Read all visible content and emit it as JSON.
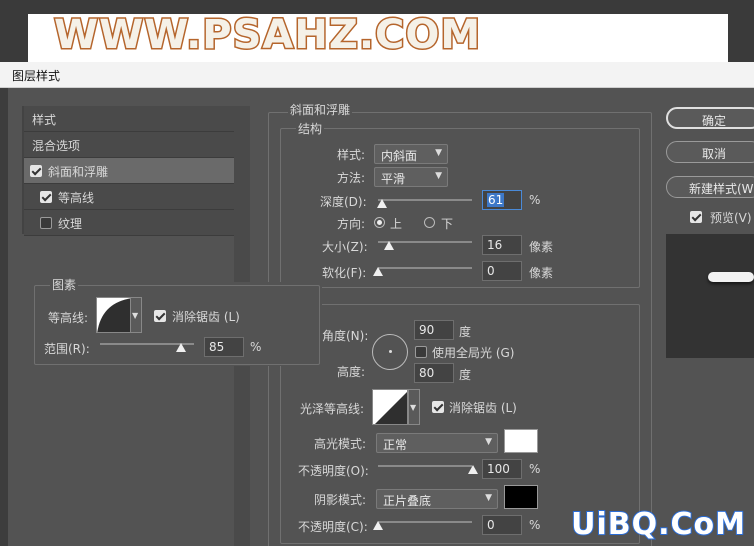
{
  "banner": {
    "text": "WWW.PSAHZ.COM"
  },
  "window": {
    "title": "图层样式"
  },
  "styles_list": {
    "items": [
      {
        "label": "样式"
      },
      {
        "label": "混合选项"
      },
      {
        "label": "斜面和浮雕",
        "checked": true,
        "selected": true
      },
      {
        "label": "等高线",
        "checked": true
      },
      {
        "label": "纹理",
        "checked": false
      }
    ]
  },
  "elements_group": {
    "title": "图素",
    "contour_label": "等高线:",
    "anti_alias_label": "消除锯齿 (L)",
    "range_label": "范围(R):",
    "range_value": "85",
    "range_unit": "%"
  },
  "bevel": {
    "section_title": "斜面和浮雕",
    "structure_title": "结构",
    "style_label": "样式:",
    "style_value": "内斜面",
    "technique_label": "方法:",
    "technique_value": "平滑",
    "depth_label": "深度(D):",
    "depth_value": "61",
    "depth_unit": "%",
    "direction_label": "方向:",
    "direction_up": "上",
    "direction_down": "下",
    "size_label": "大小(Z):",
    "size_value": "16",
    "size_unit": "像素",
    "soften_label": "软化(F):",
    "soften_value": "0",
    "soften_unit": "像素"
  },
  "shading": {
    "angle_label": "角度(N):",
    "angle_value": "90",
    "angle_unit": "度",
    "global_light_label": "使用全局光 (G)",
    "altitude_label": "高度:",
    "altitude_value": "80",
    "altitude_unit": "度",
    "gloss_contour_label": "光泽等高线:",
    "gloss_anti_alias_label": "消除锯齿 (L)",
    "highlight_mode_label": "高光模式:",
    "highlight_mode_value": "正常",
    "highlight_color": "#ffffff",
    "highlight_opacity_label": "不透明度(O):",
    "highlight_opacity_value": "100",
    "highlight_opacity_unit": "%",
    "shadow_mode_label": "阴影模式:",
    "shadow_mode_value": "正片叠底",
    "shadow_color": "#000000",
    "shadow_opacity_label": "不透明度(C):",
    "shadow_opacity_value": "0",
    "shadow_opacity_unit": "%"
  },
  "buttons": {
    "ok": "确定",
    "cancel": "取消",
    "new_style": "新建样式(W)...",
    "preview": "预览(V)"
  },
  "watermark": {
    "text": "UiBQ.CoM"
  }
}
